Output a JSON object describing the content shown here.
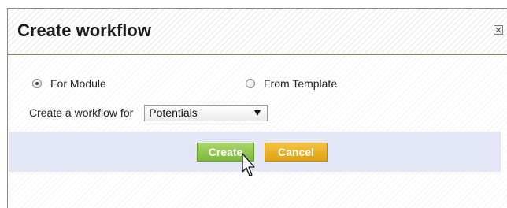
{
  "dialog": {
    "title": "Create workflow",
    "close_icon": "close-icon"
  },
  "options": {
    "for_module": {
      "label": "For Module",
      "checked": true
    },
    "from_template": {
      "label": "From Template",
      "checked": false
    }
  },
  "module_select": {
    "label": "Create a workflow for",
    "value": "Potentials"
  },
  "buttons": {
    "create": "Create",
    "cancel": "Cancel"
  },
  "colors": {
    "create_button": "#8cc44a",
    "cancel_button": "#e8ad1e",
    "footer_band": "#e3e6f6",
    "title_rule": "#8a8a77"
  },
  "cursor_icon": "pointer-cursor-icon"
}
